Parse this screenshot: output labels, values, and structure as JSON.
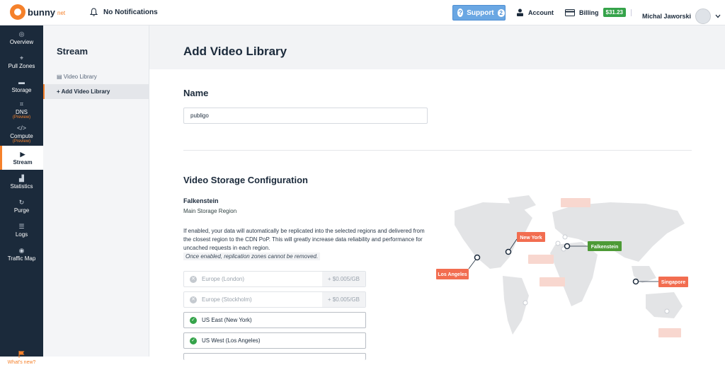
{
  "topbar": {
    "logo_text": "bunny",
    "logo_suffix": "net",
    "notifications": "No Notifications",
    "support": "Support",
    "support_count": "2",
    "account": "Account",
    "billing": "Billing",
    "balance": "$31.23",
    "user_name": "Michal Jaworski"
  },
  "sidebar": {
    "items": [
      {
        "label": "Overview"
      },
      {
        "label": "Pull Zones"
      },
      {
        "label": "Storage"
      },
      {
        "label": "DNS",
        "tag": "(Preview)"
      },
      {
        "label": "Compute",
        "tag": "(Preview)"
      },
      {
        "label": "Stream"
      },
      {
        "label": "Statistics"
      },
      {
        "label": "Purge"
      },
      {
        "label": "Logs"
      },
      {
        "label": "Traffic Map"
      }
    ],
    "whats_new": "What's new?"
  },
  "subnav": {
    "title": "Stream",
    "items": [
      "Video Library",
      "+ Add Video Library"
    ]
  },
  "page": {
    "title": "Add Video Library",
    "name_heading": "Name",
    "name_value": "publigo",
    "config_heading": "Video Storage Configuration",
    "main_region": "Falkenstein",
    "main_region_label": "Main Storage Region",
    "description": "If enabled, your data will automatically be replicated into the selected regions and delivered from the closest region to the CDN PoP. This will greatly increase data reliability and performance for uncached requests in each region.",
    "note": "Once enabled, replication zones cannot be removed.",
    "regions": [
      {
        "name": "Europe (London)",
        "price": "+ $0.005/GB",
        "enabled": false
      },
      {
        "name": "Europe (Stockholm)",
        "price": "+ $0.005/GB",
        "enabled": false
      },
      {
        "name": "US East (New York)",
        "price": "",
        "enabled": true
      },
      {
        "name": "US West (Los Angeles)",
        "price": "",
        "enabled": true
      }
    ]
  },
  "map": {
    "labels": [
      "New York",
      "Falkenstein",
      "Los Angeles",
      "Singapore"
    ],
    "colors": {
      "active": "#f26d50",
      "main": "#4d9a36",
      "faded": "#f8c9bf"
    }
  },
  "colors": {
    "accent": "#f5812b",
    "sidebar": "#1b2a3b",
    "support": "#6aa7e3",
    "success": "#35a34a"
  }
}
